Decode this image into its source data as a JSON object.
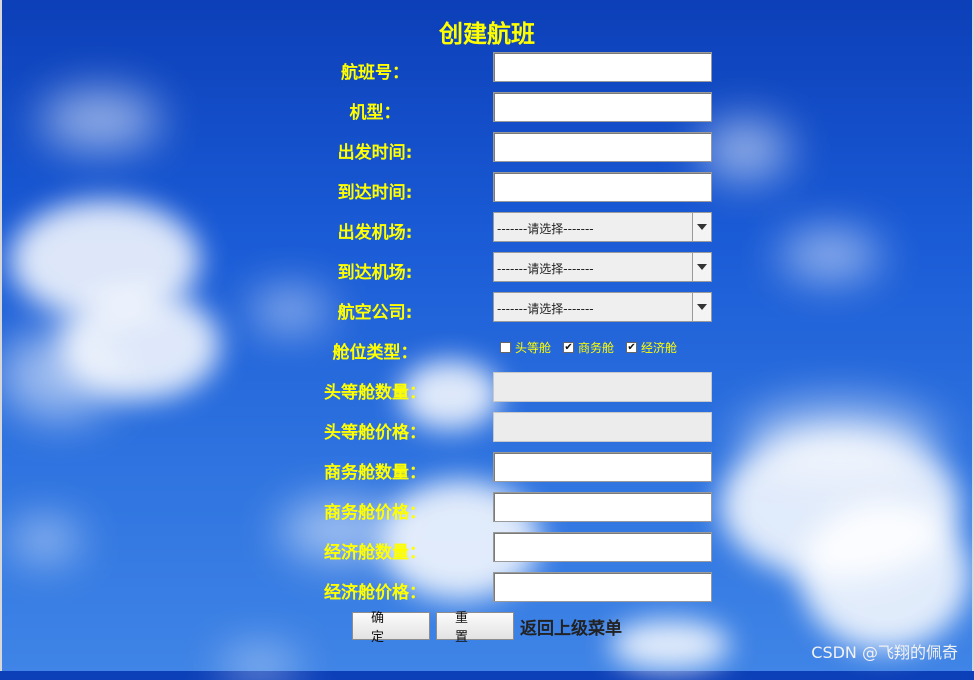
{
  "title": "创建航班",
  "fields": [
    {
      "label": "航班号：",
      "kind": "text"
    },
    {
      "label": "机型：",
      "kind": "text"
    },
    {
      "label": "出发时间:",
      "kind": "text"
    },
    {
      "label": "到达时间:",
      "kind": "text"
    },
    {
      "label": "出发机场:",
      "kind": "select",
      "value": "-------请选择-------"
    },
    {
      "label": "到达机场:",
      "kind": "select",
      "value": "-------请选择-------"
    },
    {
      "label": "航空公司:",
      "kind": "select",
      "value": "-------请选择-------"
    },
    {
      "label": "舱位类型："
    },
    {
      "label": "头等舱数量："
    },
    {
      "label": "头等舱价格："
    },
    {
      "label": "商务舱数量："
    },
    {
      "label": "商务舱价格："
    },
    {
      "label": "经济舱数量："
    },
    {
      "label": "经济舱价格："
    }
  ],
  "cabin_types": [
    {
      "label": "头等舱",
      "checked": false
    },
    {
      "label": "商务舱",
      "checked": true
    },
    {
      "label": "经济舱",
      "checked": true
    }
  ],
  "buttons": {
    "confirm": "确定",
    "reset": "重置",
    "back": "返回上级菜单"
  },
  "watermark": "CSDN @飞翔的佩奇",
  "colors": {
    "label": "#ffff00",
    "sky": "#1a5bd6"
  }
}
